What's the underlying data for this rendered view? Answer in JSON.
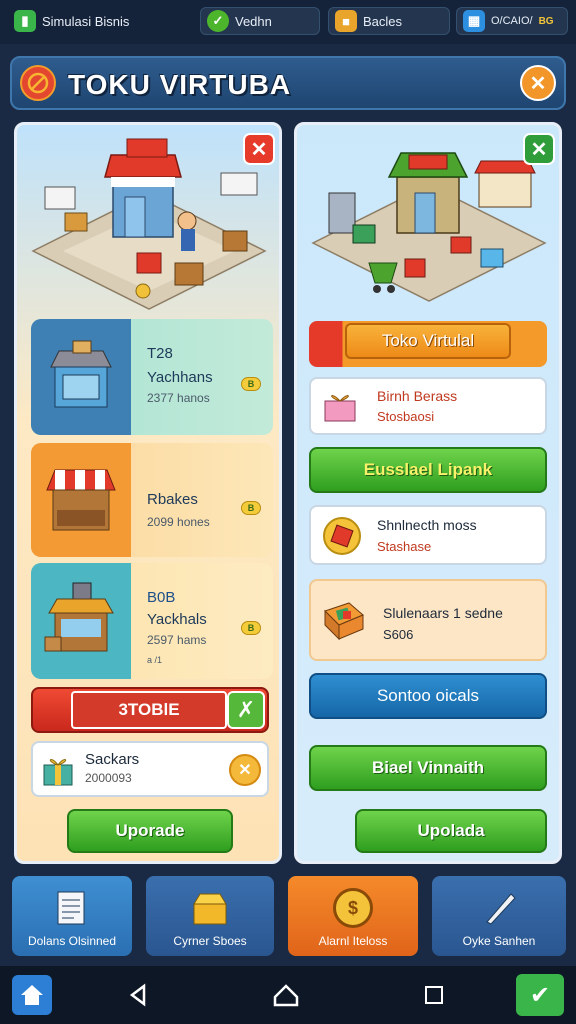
{
  "status": {
    "app": "Simulasi Bisnis",
    "item2": "Vedhn",
    "item3": "Bacles",
    "item4": "O/CAIO/",
    "item4_badge": "BG"
  },
  "header": {
    "title": "TOKU VIRTUBA"
  },
  "left": {
    "cards": [
      {
        "title": "T28",
        "name": "Yachhans",
        "sub": "2377 hanos",
        "coin": "B"
      },
      {
        "name": "Rbakes",
        "sub": "2099 hones",
        "coin": "B"
      },
      {
        "title": "B0B",
        "name": "Yackhals",
        "sub": "2597 hams",
        "extra": "a /1",
        "coin": "B"
      }
    ],
    "stoble_label": "3TOBlE",
    "sackars": {
      "name": "Sackars",
      "value": "2000093"
    },
    "upgrade_label": "Uporade"
  },
  "right": {
    "toko_label": "Toko Virtulal",
    "item1": {
      "name": "Birnh Berass",
      "sub": "Stosbaosi"
    },
    "green1_label": "Eusslael Lipank",
    "item2": {
      "name": "Shnlnecth moss",
      "sub": "Stashase"
    },
    "item3": {
      "name": "Slulenaars 1 sedne",
      "sub": "S606"
    },
    "blue_label": "Sontoo oicals",
    "green2_label": "Biael Vinnaith",
    "green3_label": "Upolada"
  },
  "tabs": [
    "Dolans Olsinned",
    "Cyrner Sboes",
    "Alarnl Iteloss",
    "Oyke Sanhen"
  ],
  "colors": {
    "accent_green": "#3aa82a",
    "accent_red": "#e23a2a",
    "accent_orange": "#f08a1c",
    "accent_blue": "#1d6fb4"
  }
}
